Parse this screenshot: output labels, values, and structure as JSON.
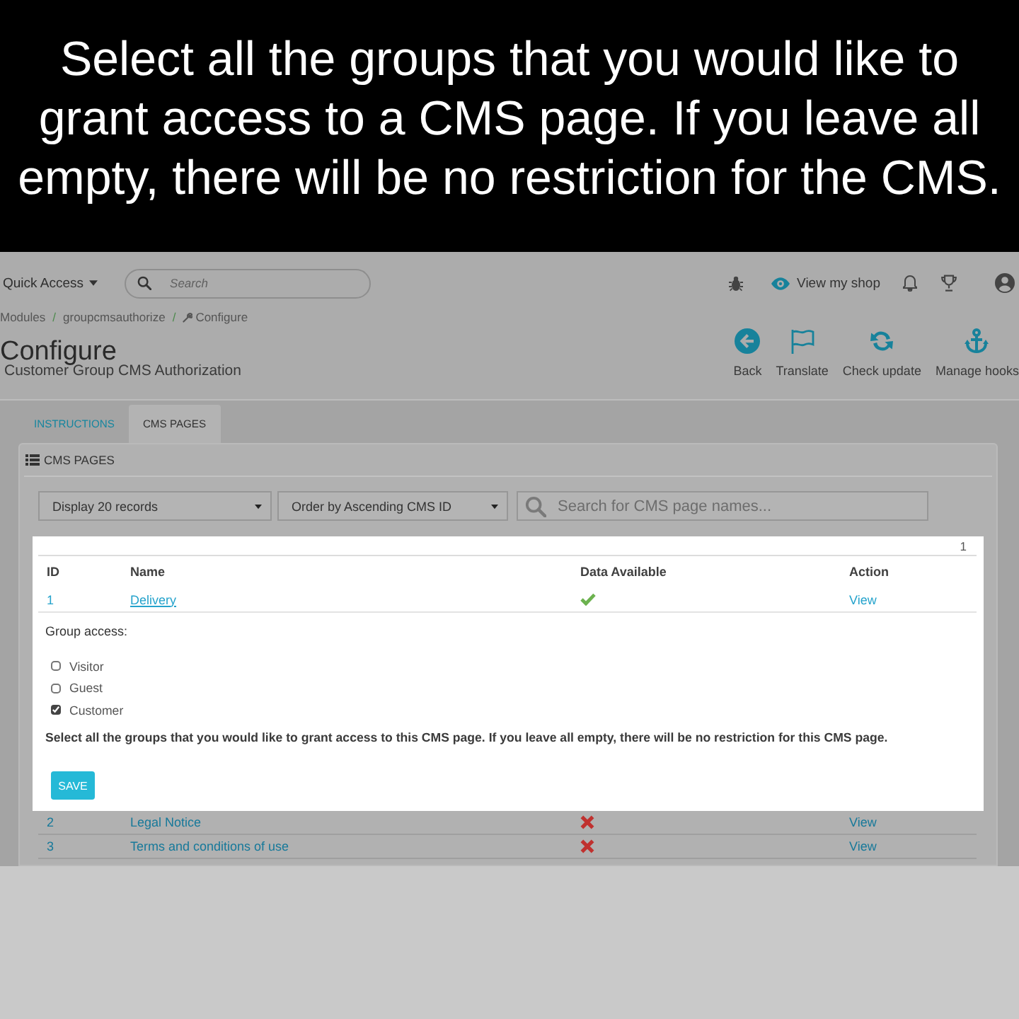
{
  "caption": "Select all the groups that you would like to grant access to a CMS page. If you leave all empty, there will be no restriction for the CMS.",
  "top_bar": {
    "quick_access": "Quick Access",
    "search": {
      "placeholder": "Search"
    },
    "view_shop": "View my shop"
  },
  "breadcrumb": {
    "items": [
      "Modules",
      "groupcmsauthorize",
      "Configure"
    ],
    "separator": "/"
  },
  "header": {
    "title": "Configure",
    "subtitle": "Customer Group CMS Authorization",
    "toolbar": [
      {
        "kind": "back",
        "label": "Back"
      },
      {
        "kind": "translate",
        "label": "Translate"
      },
      {
        "kind": "update",
        "label": "Check update"
      },
      {
        "kind": "hooks",
        "label": "Manage hooks"
      }
    ]
  },
  "tabs": [
    {
      "label": "INSTRUCTIONS",
      "selected": false
    },
    {
      "label": "CMS PAGES",
      "selected": true
    }
  ],
  "panel": {
    "title": "CMS PAGES",
    "filters": {
      "display": "Display 20 records",
      "order": "Order by Ascending CMS ID",
      "search": {
        "placeholder": "Search for CMS page names..."
      }
    },
    "pagination": [
      "1"
    ],
    "table": {
      "columns": [
        "ID",
        "Name",
        "Data Available",
        "Action"
      ],
      "rows": [
        {
          "id": "1",
          "name": "Delivery",
          "data_available": true,
          "action": "View",
          "expanded": true,
          "details": {
            "label": "Group access:",
            "groups": [
              {
                "label": "Visitor",
                "checked": false
              },
              {
                "label": "Guest",
                "checked": false
              },
              {
                "label": "Customer",
                "checked": true
              }
            ],
            "note": "Select all the groups that you would like to grant access to this CMS page. If you leave all empty, there will be no restriction for this CMS page.",
            "button": "SAVE"
          }
        },
        {
          "id": "2",
          "name": "Legal Notice",
          "data_available": false,
          "action": "View",
          "expanded": false
        },
        {
          "id": "3",
          "name": "Terms and conditions of use",
          "data_available": false,
          "action": "View",
          "expanded": false
        }
      ]
    }
  }
}
